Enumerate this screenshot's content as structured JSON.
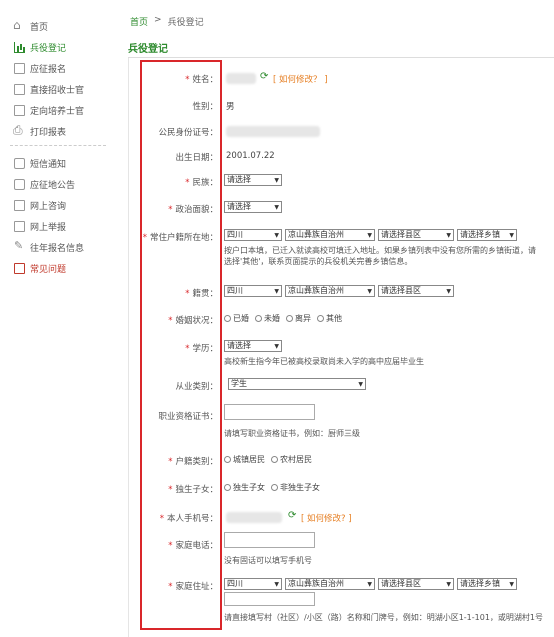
{
  "sidebar": {
    "items": [
      {
        "label": "首页"
      },
      {
        "label": "兵役登记"
      },
      {
        "label": "应征报名"
      },
      {
        "label": "直接招收士官"
      },
      {
        "label": "定向培养士官"
      },
      {
        "label": "打印报表"
      },
      {
        "label": "短信通知"
      },
      {
        "label": "应征地公告"
      },
      {
        "label": "网上咨询"
      },
      {
        "label": "网上举报"
      },
      {
        "label": "往年报名信息"
      },
      {
        "label": "常见问题"
      }
    ]
  },
  "breadcrumb": {
    "home": "首页",
    "sep": ">",
    "current": "兵役登记"
  },
  "page_title": "兵役登记",
  "form": {
    "name_label": "姓名：",
    "how_modify": "[ 如何修改？ ]",
    "gender_label": "性别：",
    "gender_value": "男",
    "id_label": "公民身份证号：",
    "birth_label": "出生日期：",
    "birth_value": "2001.07.22",
    "ethnicity_label": "民族：",
    "ethnicity_value": "请选择",
    "politics_label": "政治面貌：",
    "politics_value": "请选择",
    "residence_label": "常住户籍所在地：",
    "province": "四川",
    "prefecture": "凉山彝族自治州",
    "county": "请选择县区",
    "town": "请选择乡镇",
    "residence_hint": "按户口本填，已迁入就读高校可填迁入地址。如果乡镇列表中没有您所需的乡镇街道，请选择'其他'，联系页面提示的兵役机关完善乡镇信息。",
    "native_label": "籍贯：",
    "marital_label": "婚姻状况：",
    "marital_options": [
      "已婚",
      "未婚",
      "离异",
      "其他"
    ],
    "education_label": "学历：",
    "education_value": "请选择",
    "education_hint": "高校新生指今年已被高校录取尚未入学的高中应届毕业生",
    "occupation_label": "从业类别：",
    "occupation_value": "学生",
    "cert_label": "职业资格证书：",
    "cert_hint": "请填写职业资格证书，例如：厨师三级",
    "household_label": "户籍类别：",
    "household_options": [
      "城镇居民",
      "农村居民"
    ],
    "only_child_label": "独生子女：",
    "only_child_options": [
      "独生子女",
      "非独生子女"
    ],
    "phone_label": "本人手机号：",
    "phone_how_modify": "[ 如何修改? ]",
    "home_phone_label": "家庭电话：",
    "home_phone_hint": "没有固话可以填写手机号",
    "address_label": "家庭住址：",
    "address_hint": "请直接填写村（社区）/小区（路）名称和门牌号，例如：明湖小区1-1-101，或明湖村1号"
  },
  "colors": {
    "accent": "#2e8b2e",
    "highlight": "#d9262a",
    "link": "#e67e22"
  }
}
